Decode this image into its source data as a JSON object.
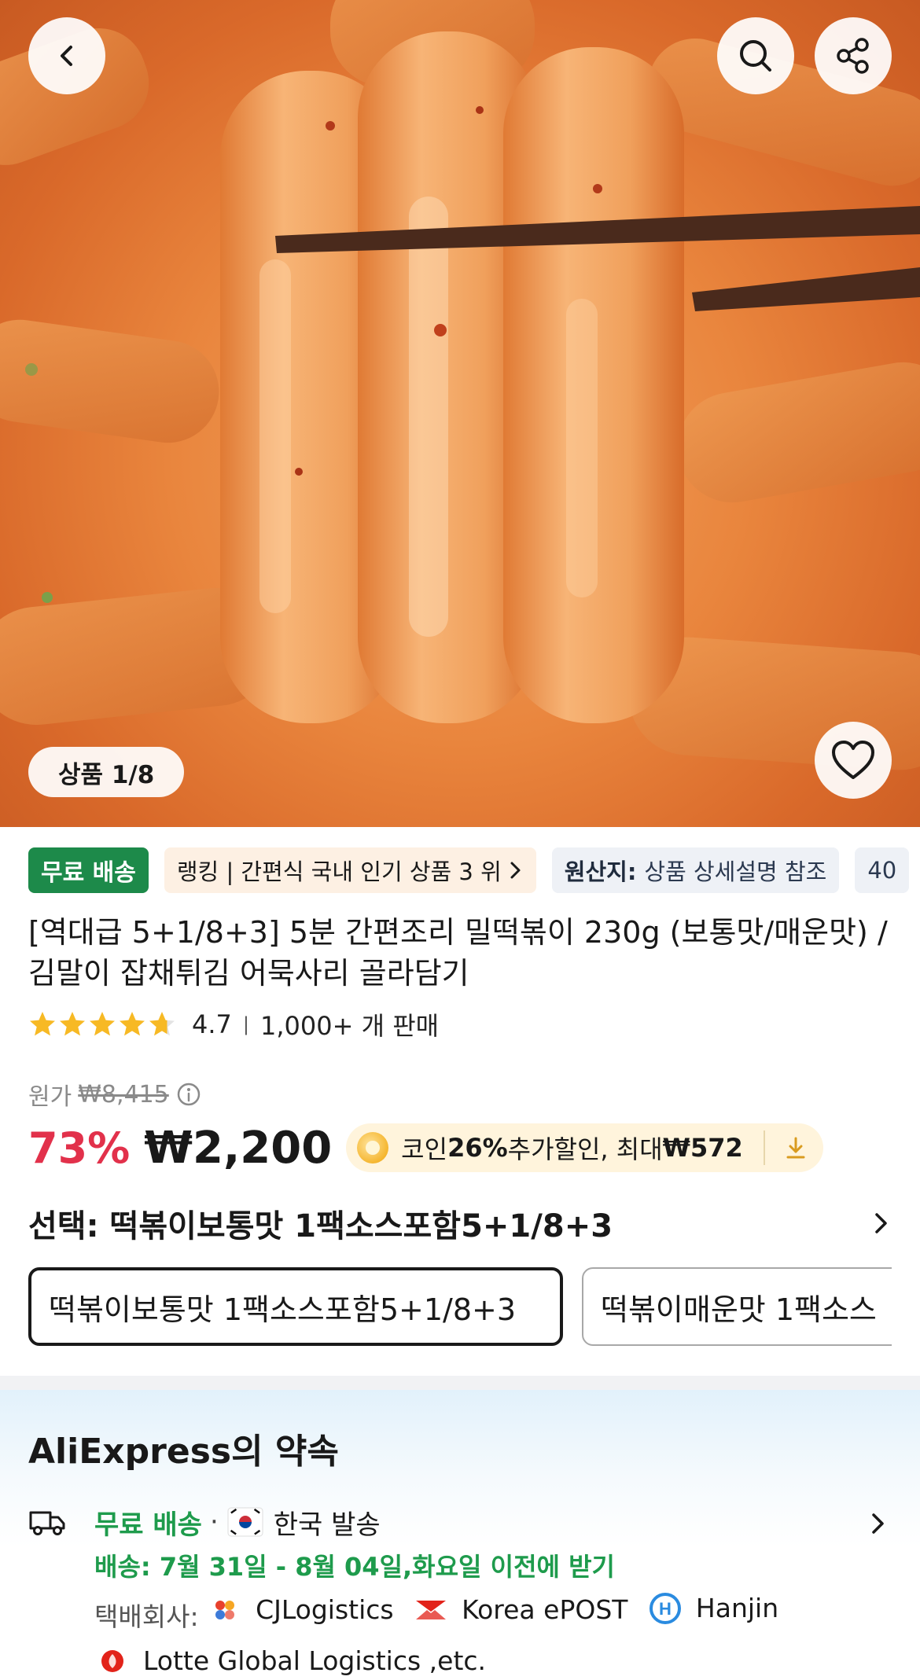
{
  "gallery": {
    "counter": "상품 1/8"
  },
  "tags": {
    "free_shipping": "무료 배송",
    "ranking": "랭킹 | 간편식 국내 인기 상품 3 위",
    "origin_key": "원산지:",
    "origin_value": "상품 상세설명 참조",
    "extra": "40"
  },
  "product": {
    "title": "[역대급 5+1/8+3] 5분 간편조리 밀떡볶이 230g (보통맛/매운맛) / 김말이 잡채튀김 어묵사리 골라담기",
    "rating": "4.7",
    "rating_fill": 0.94,
    "sold": "1,000+ 개 판매"
  },
  "pricing": {
    "original_label": "원가",
    "original_price": "₩8,415",
    "discount": "73%",
    "price": "₩2,200",
    "coin_text_pre": "코인 ",
    "coin_percent": "26%",
    "coin_text_mid": " 추가할인, 최대 ",
    "coin_max": "₩572"
  },
  "variant": {
    "select_label": "선택: 떡볶이보통맛 1팩소스포함5+1/8+3",
    "options": [
      "떡볶이보통맛 1팩소스포함5+1/8+3",
      "떡볶이매운맛 1팩소스"
    ]
  },
  "promise": {
    "title": "AliExpress의 약속",
    "free_shipping": "무료 배송",
    "separator": "·",
    "ships_from": "한국 발송",
    "delivery": "배송: 7월 31일 - 8월 04일,화요일 이전에 받기",
    "carrier_label": "택배회사:",
    "carriers": [
      "CJLogistics",
      "Korea ePOST",
      "Hanjin",
      "Lotte Global Logistics ,etc."
    ]
  },
  "colors": {
    "accent_red": "#e2314b",
    "free_green": "#1d8a4a",
    "delivery_green": "#1e9b4c"
  }
}
